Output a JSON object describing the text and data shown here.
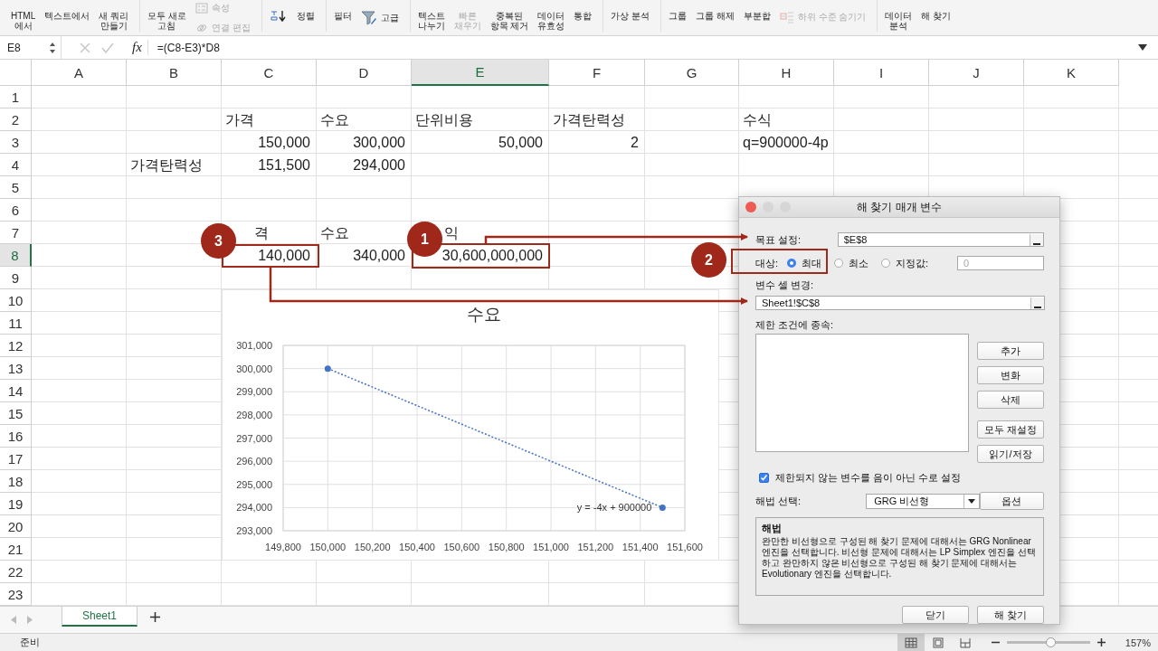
{
  "ribbon": {
    "groups": [
      {
        "items": [
          {
            "kind": "large",
            "label": "HTML\n에서",
            "disabled": false
          },
          {
            "kind": "large",
            "label": "텍스트에서",
            "disabled": false
          },
          {
            "kind": "large",
            "label": "새 쿼리\n만들기",
            "disabled": false
          }
        ]
      },
      {
        "items": [
          {
            "kind": "large",
            "label": "모두 새로\n고침",
            "disabled": false
          },
          {
            "kind": "stack",
            "items": [
              {
                "kind": "small",
                "label": "속성",
                "disabled": true
              },
              {
                "kind": "small",
                "label": "연결 편집",
                "disabled": true
              }
            ]
          }
        ]
      },
      {
        "items": [
          {
            "kind": "icon",
            "disabled": false
          },
          {
            "kind": "large",
            "label": "정렬",
            "disabled": false
          }
        ]
      },
      {
        "items": [
          {
            "kind": "large",
            "label": "필터",
            "disabled": false
          },
          {
            "kind": "small",
            "label": "고급",
            "disabled": false
          }
        ]
      },
      {
        "items": [
          {
            "kind": "large",
            "label": "텍스트\n나누기",
            "disabled": false
          },
          {
            "kind": "large",
            "label": "빠른\n채우기",
            "disabled": true
          },
          {
            "kind": "large",
            "label": "중복된\n항목 제거",
            "disabled": false
          },
          {
            "kind": "large",
            "label": "데이터\n유효성",
            "disabled": false
          },
          {
            "kind": "large",
            "label": "통합",
            "disabled": false
          }
        ]
      },
      {
        "items": [
          {
            "kind": "large",
            "label": "가상 분석",
            "disabled": false
          }
        ]
      },
      {
        "items": [
          {
            "kind": "large",
            "label": "그룹",
            "disabled": false
          },
          {
            "kind": "large",
            "label": "그룹 해제",
            "disabled": false
          },
          {
            "kind": "large",
            "label": "부분합",
            "disabled": false
          },
          {
            "kind": "small",
            "label": "하위 수준 숨기기",
            "disabled": true
          }
        ]
      },
      {
        "items": [
          {
            "kind": "large",
            "label": "데이터\n분석",
            "disabled": false
          },
          {
            "kind": "large",
            "label": "해 찾기",
            "disabled": false
          }
        ]
      }
    ]
  },
  "formula_bar": {
    "name_box": "E8",
    "function_label": "fx",
    "formula": "=(C8-E3)*D8"
  },
  "sheet": {
    "columns": [
      {
        "label": "A",
        "selected": false
      },
      {
        "label": "B",
        "selected": false
      },
      {
        "label": "C",
        "selected": false
      },
      {
        "label": "D",
        "selected": false
      },
      {
        "label": "E",
        "selected": true
      },
      {
        "label": "F",
        "selected": false
      },
      {
        "label": "G",
        "selected": false
      },
      {
        "label": "H",
        "selected": false
      },
      {
        "label": "I",
        "selected": false
      },
      {
        "label": "J",
        "selected": false
      },
      {
        "label": "K",
        "selected": false
      }
    ],
    "rows": [
      {
        "number": "1"
      },
      {
        "number": "2",
        "cells": [
          null,
          null,
          {
            "text": "가격",
            "kind": "text"
          },
          {
            "text": "수요",
            "kind": "text"
          },
          {
            "text": "단위비용",
            "kind": "text"
          },
          {
            "text": "가격탄력성",
            "kind": "text"
          },
          null,
          {
            "text": "수식",
            "kind": "text"
          },
          null,
          null,
          null
        ]
      },
      {
        "number": "3",
        "cells": [
          null,
          null,
          {
            "text": "150,000",
            "kind": "number"
          },
          {
            "text": "300,000",
            "kind": "number"
          },
          {
            "text": "50,000",
            "kind": "number"
          },
          {
            "text": "2",
            "kind": "number"
          },
          null,
          {
            "text": "q=900000-4p",
            "kind": "text"
          },
          null,
          null,
          null
        ]
      },
      {
        "number": "4",
        "cells": [
          null,
          {
            "text": "가격탄력성",
            "kind": "text"
          },
          {
            "text": "151,500",
            "kind": "number"
          },
          {
            "text": "294,000",
            "kind": "number"
          },
          null,
          null,
          null,
          null,
          null,
          null,
          null
        ]
      },
      {
        "number": "5"
      },
      {
        "number": "6"
      },
      {
        "number": "7",
        "cells": [
          null,
          null,
          {
            "text": "격",
            "kind": "partial"
          },
          {
            "text": "수요",
            "kind": "text"
          },
          {
            "text": "익",
            "kind": "partial"
          },
          null,
          null,
          null,
          null,
          null,
          null
        ]
      },
      {
        "number": "8",
        "selected": true,
        "cells": [
          null,
          null,
          {
            "text": "140,000",
            "kind": "number"
          },
          {
            "text": "340,000",
            "kind": "number"
          },
          {
            "text": "30,600,000,000",
            "kind": "number"
          },
          null,
          null,
          null,
          null,
          null,
          null
        ]
      },
      {
        "number": "9"
      },
      {
        "number": "10"
      },
      {
        "number": "11"
      },
      {
        "number": "12"
      },
      {
        "number": "13"
      },
      {
        "number": "14"
      },
      {
        "number": "15"
      },
      {
        "number": "16"
      },
      {
        "number": "17"
      },
      {
        "number": "18"
      },
      {
        "number": "19"
      },
      {
        "number": "20"
      },
      {
        "number": "21"
      },
      {
        "number": "22"
      },
      {
        "number": "23"
      }
    ]
  },
  "chart": {
    "chart_data": {
      "type": "scatter",
      "title": "수요",
      "x": [
        150000,
        151500
      ],
      "series": [
        {
          "color": "#4472c4",
          "values": [
            300000,
            294000
          ]
        }
      ],
      "xlim": [
        149800,
        151600
      ],
      "ylim": [
        293000,
        301000
      ],
      "xticks": [
        {
          "value": 149800,
          "label": "149,800"
        },
        {
          "value": 150000,
          "label": "150,000"
        },
        {
          "value": 150200,
          "label": "150,200"
        },
        {
          "value": 150400,
          "label": "150,400"
        },
        {
          "value": 150600,
          "label": "150,600"
        },
        {
          "value": 150800,
          "label": "150,800"
        },
        {
          "value": 151000,
          "label": "151,000"
        },
        {
          "value": 151200,
          "label": "151,200"
        },
        {
          "value": 151400,
          "label": "151,400"
        },
        {
          "value": 151600,
          "label": "151,600"
        }
      ],
      "yticks": [
        {
          "value": 293000,
          "label": "293,000"
        },
        {
          "value": 294000,
          "label": "294,000"
        },
        {
          "value": 295000,
          "label": "295,000"
        },
        {
          "value": 296000,
          "label": "296,000"
        },
        {
          "value": 297000,
          "label": "297,000"
        },
        {
          "value": 298000,
          "label": "298,000"
        },
        {
          "value": 299000,
          "label": "299,000"
        },
        {
          "value": 300000,
          "label": "300,000"
        },
        {
          "value": 301000,
          "label": "301,000"
        }
      ],
      "grid": true,
      "annotations": [
        {
          "text": "y = -4x + 900000"
        }
      ]
    }
  },
  "solver_dialog": {
    "title": "해 찾기 매개 변수",
    "objective": {
      "label": "목표 설정:",
      "value": "$E$8"
    },
    "target": {
      "label": "대상:",
      "options": [
        {
          "label": "최대",
          "selected": true
        },
        {
          "label": "최소",
          "selected": false
        },
        {
          "label": "지정값:",
          "selected": false
        }
      ],
      "value_field": "0"
    },
    "variables": {
      "label": "변수 셀 변경:",
      "value": "Sheet1!$C$8"
    },
    "constraints": {
      "label": "제한 조건에 종속:",
      "buttons": [
        "추가",
        "변화",
        "삭제",
        "모두 재설정",
        "읽기/저장"
      ]
    },
    "nonnegative": {
      "label": "제한되지 않는 변수를 음이 아닌 수로 설정",
      "checked": true
    },
    "method": {
      "label": "해법 선택:",
      "value": "GRG 비선형",
      "options_button": "옵션"
    },
    "method_help": {
      "title": "해법",
      "text": "완만한 비선형으로 구성된 해 찾기 문제에 대해서는 GRG Nonlinear 엔진을 선택합니다. 비선형 문제에 대해서는 LP Simplex 엔진을 선택하고 완만하지 않은 비선형으로 구성된 해 찾기 문제에 대해서는 Evolutionary 엔진을 선택합니다."
    },
    "buttons": [
      "닫기",
      "해 찾기"
    ]
  },
  "annotations": {
    "markers": [
      {
        "number": "1"
      },
      {
        "number": "2"
      },
      {
        "number": "3"
      }
    ]
  },
  "sheet_tabs": [
    {
      "label": "Sheet1",
      "selected": true
    }
  ],
  "status_bar": {
    "status": "준비",
    "views": [
      {
        "kind": "normal",
        "selected": true
      },
      {
        "kind": "page-layout",
        "selected": false
      },
      {
        "kind": "page-break",
        "selected": false
      }
    ],
    "zoom": {
      "level": 0.52
    },
    "zoom_label": "157%"
  }
}
